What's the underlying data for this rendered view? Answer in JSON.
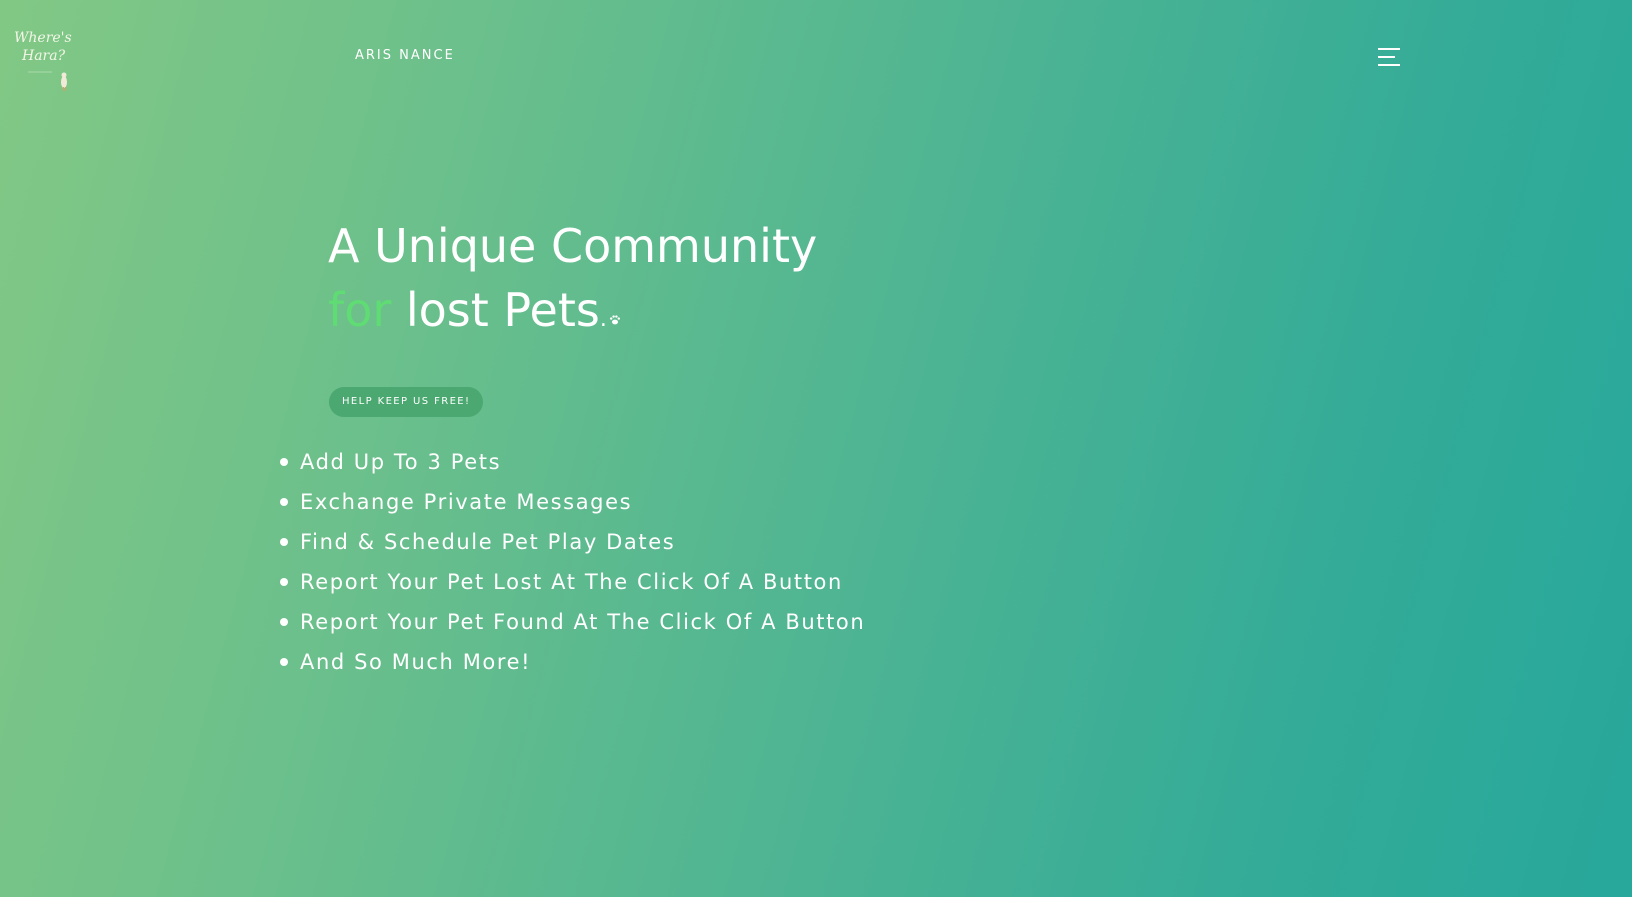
{
  "brand": {
    "logo_text_line1": "Where's",
    "logo_text_line2": "Hara?",
    "logo_icon": "dog-logo-icon"
  },
  "nav": {
    "name_link": "ARIS NANCE",
    "menu_icon": "hamburger-menu-icon"
  },
  "hero": {
    "title_line1": "A Unique Community",
    "title_accent": "for",
    "title_rest": "lost Pets",
    "title_period": ".",
    "paw_icon": "paw-icon",
    "accent_color": "#5fdc73",
    "cta_label": "HELP KEEP US FREE!"
  },
  "features": [
    "Add Up To 3 Pets",
    "Exchange Private Messages",
    "Find & Schedule Pet Play Dates",
    "Report Your Pet Lost At The Click Of A Button",
    "Report Your Pet Found At The Click Of A Button",
    "And So Much More!"
  ],
  "colors": {
    "gradient_start": "#82c885",
    "gradient_end": "#27a89b",
    "button_bg": "#4aa870"
  }
}
